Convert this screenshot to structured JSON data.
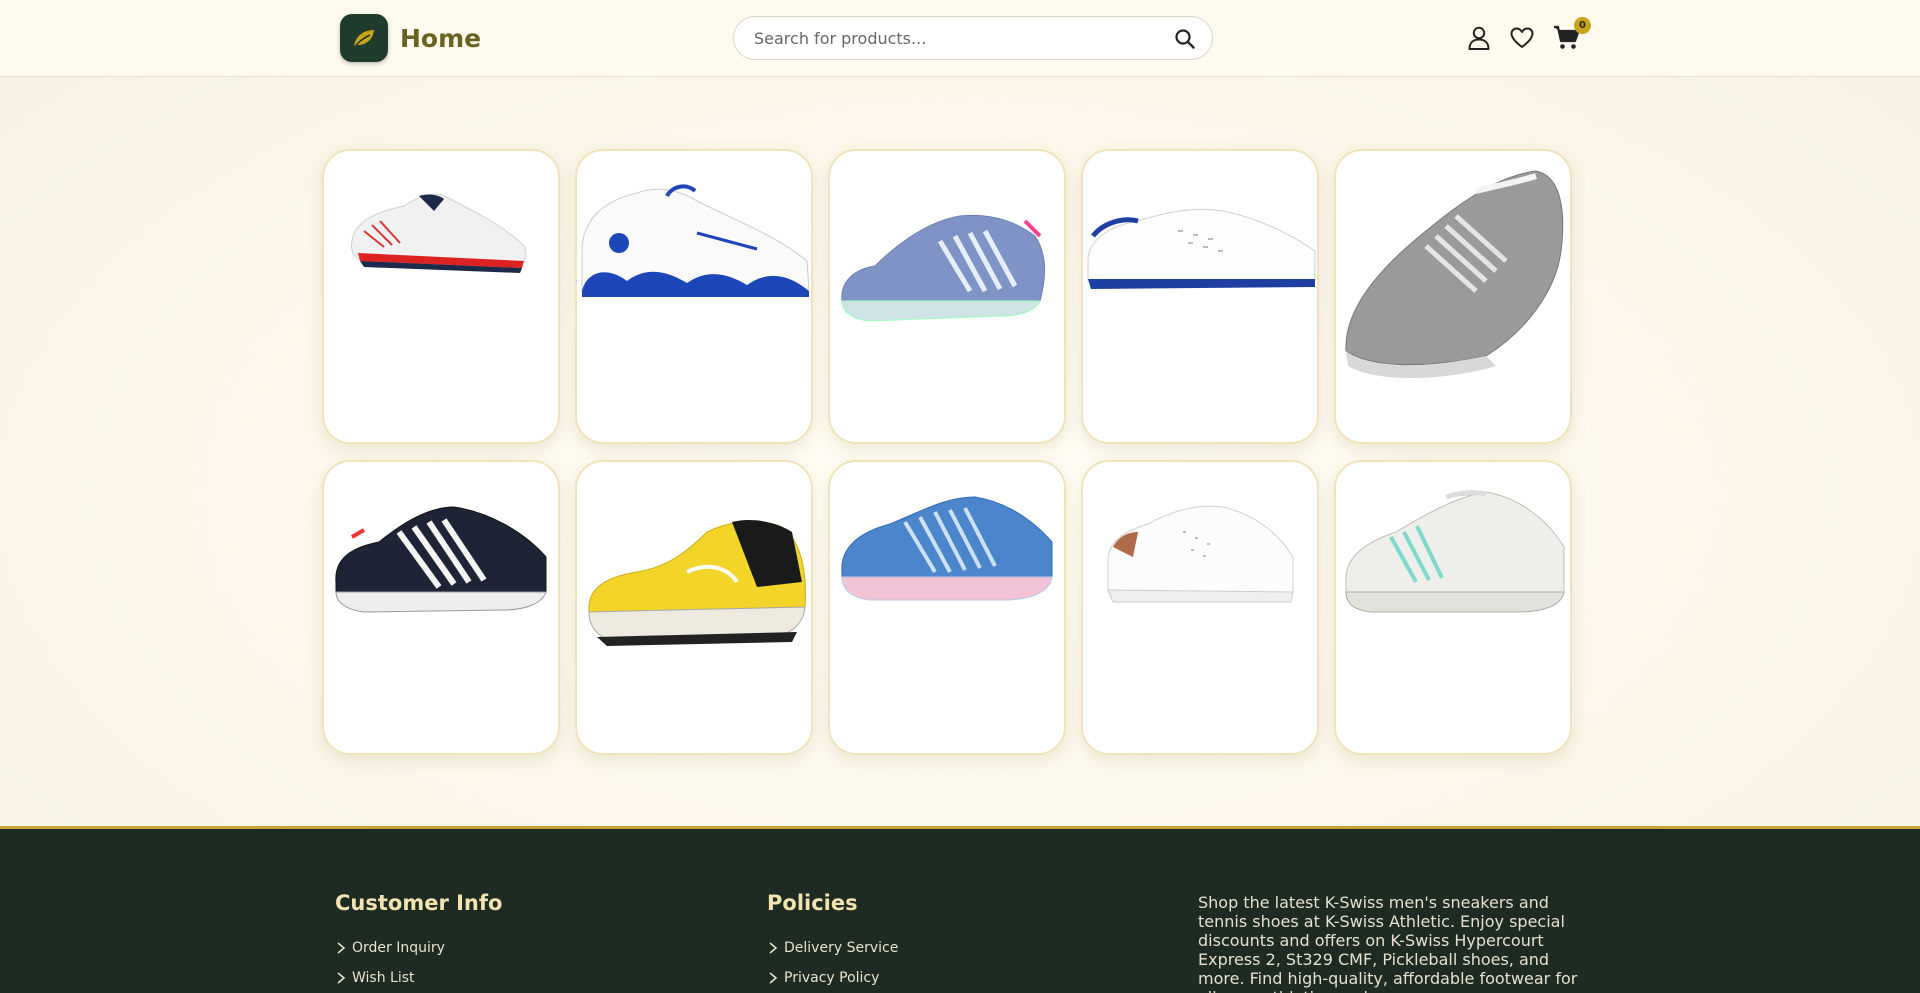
{
  "header": {
    "logo_icon": "leaf-icon",
    "title": "Home",
    "search_placeholder": "Search for products...",
    "search_icon": "search-icon",
    "account_icon": "user-icon",
    "wishlist_icon": "heart-icon",
    "cart_icon": "cart-icon",
    "cart_count": "0"
  },
  "products": [
    {
      "image": "white-navy-red-sneaker"
    },
    {
      "image": "white-blue-kswiss-classic"
    },
    {
      "image": "lavender-blue-tennis-shoe"
    },
    {
      "image": "white-blue-court-sneaker"
    },
    {
      "image": "grey-white-hypercourt"
    },
    {
      "image": "navy-white-tennis-shoe"
    },
    {
      "image": "yellow-black-pickleball-shoe"
    },
    {
      "image": "blue-pink-tennis-shoe"
    },
    {
      "image": "white-copper-sneaker"
    },
    {
      "image": "white-mint-tennis-shoe"
    }
  ],
  "footer": {
    "customer_info": {
      "title": "Customer Info",
      "links": [
        "Order Inquiry",
        "Wish List"
      ]
    },
    "policies": {
      "title": "Policies",
      "links": [
        "Delivery Service",
        "Privacy Policy"
      ]
    },
    "description": "Shop the latest K-Swiss men's sneakers and tennis shoes at K-Swiss Athletic. Enjoy special discounts and offers on K-Swiss Hypercourt Express 2, St329 CMF, Pickleball shoes, and more. Find high-quality, affordable footwear for all your athletic needs."
  },
  "colors": {
    "header_bg": "#fefbee",
    "footer_bg": "#1d2b22",
    "accent_gold": "#c9a41a",
    "brand_green": "#1e3b2c"
  }
}
